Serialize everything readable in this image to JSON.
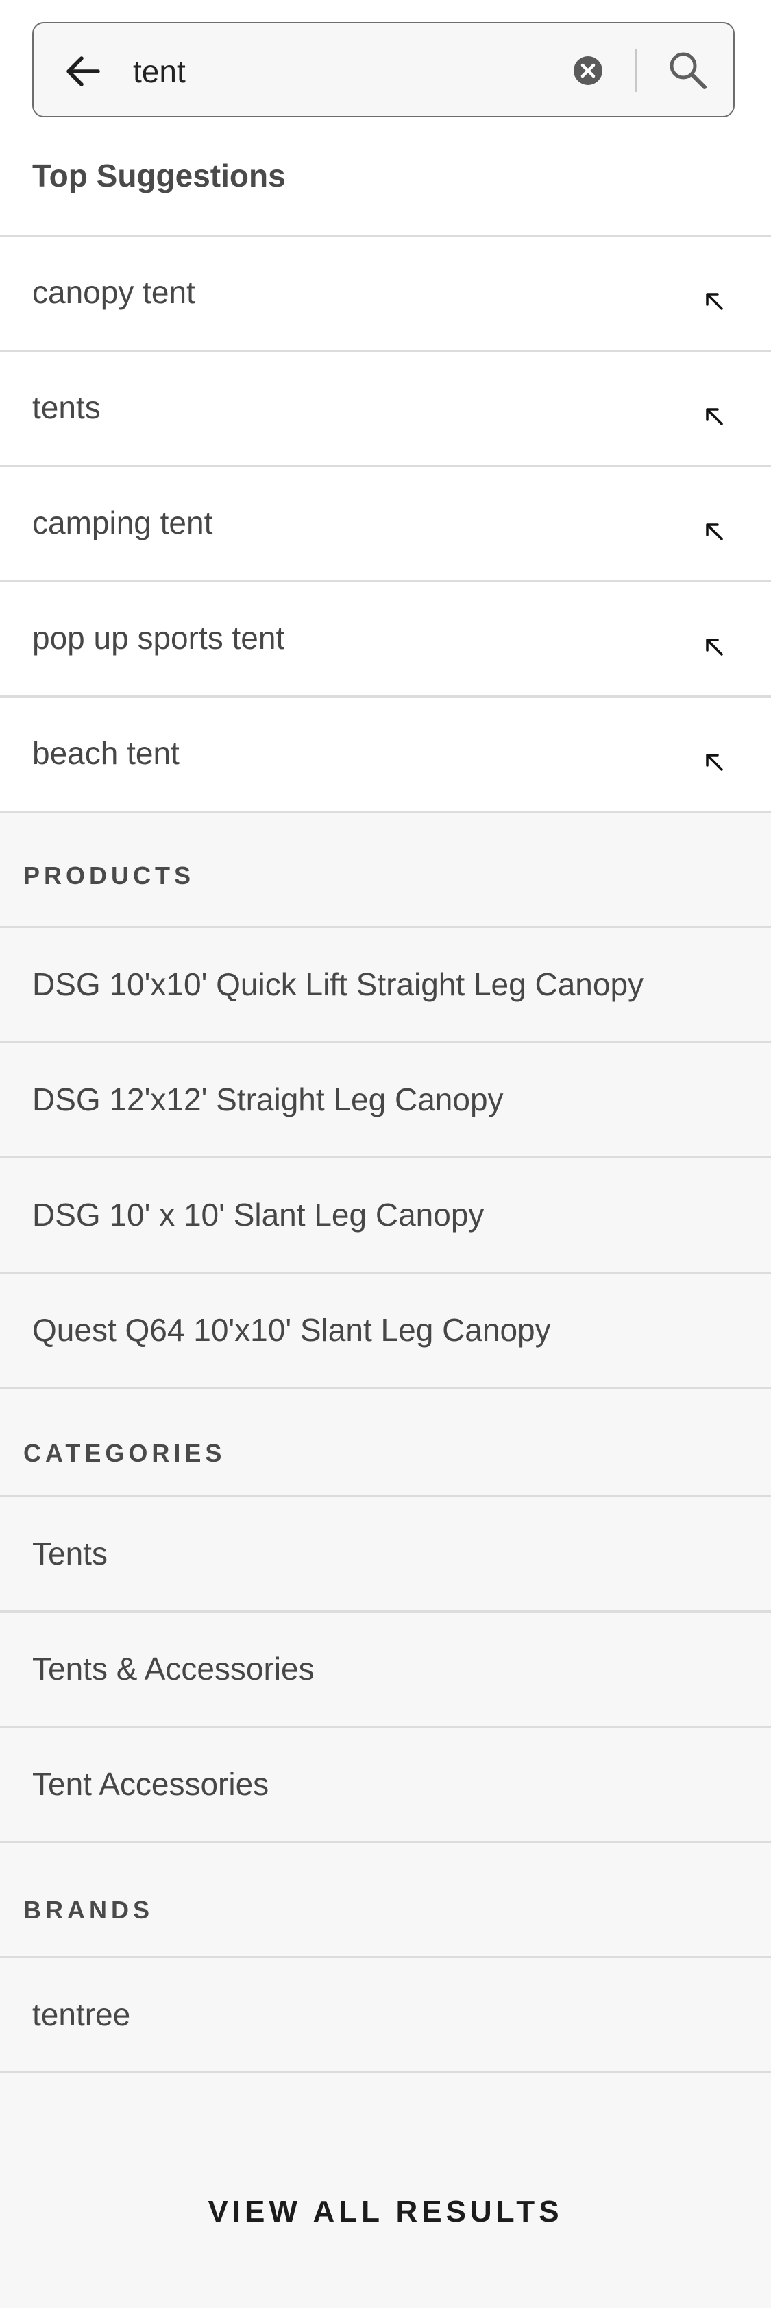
{
  "search": {
    "value": "tent",
    "placeholder": "Search"
  },
  "icons": {
    "back": "arrow-left-icon",
    "clear": "clear-circle-x-icon",
    "search": "magnifier-icon",
    "fill": "arrow-up-left-icon"
  },
  "top_suggestions": {
    "title": "Top Suggestions",
    "items": [
      {
        "label": "canopy tent"
      },
      {
        "label": "tents"
      },
      {
        "label": "camping tent"
      },
      {
        "label": "pop up sports tent"
      },
      {
        "label": "beach tent"
      }
    ]
  },
  "products": {
    "title": "PRODUCTS",
    "items": [
      {
        "label": "DSG 10'x10' Quick Lift Straight Leg Canopy"
      },
      {
        "label": "DSG 12'x12' Straight Leg Canopy"
      },
      {
        "label": "DSG 10' x 10' Slant Leg Canopy"
      },
      {
        "label": "Quest Q64 10'x10' Slant Leg Canopy"
      }
    ]
  },
  "categories": {
    "title": "CATEGORIES",
    "items": [
      {
        "label": "Tents"
      },
      {
        "label": "Tents & Accessories"
      },
      {
        "label": "Tent Accessories"
      }
    ]
  },
  "brands": {
    "title": "BRANDS",
    "items": [
      {
        "label": "tentree"
      }
    ]
  },
  "footer": {
    "view_all_label": "VIEW ALL RESULTS"
  },
  "colors": {
    "background": "#f7f7f7",
    "surface": "#ffffff",
    "text": "#474747",
    "divider": "#dcdcdc"
  }
}
